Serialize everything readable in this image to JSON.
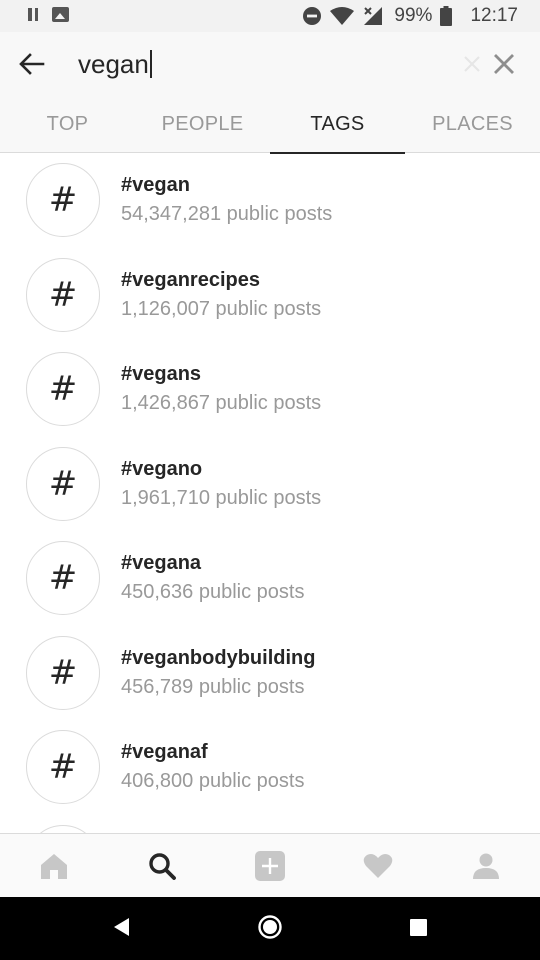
{
  "status_bar": {
    "battery_percent": "99%",
    "time": "12:17"
  },
  "search": {
    "query": "vegan"
  },
  "tabs": [
    {
      "label": "TOP",
      "active": false
    },
    {
      "label": "PEOPLE",
      "active": false
    },
    {
      "label": "TAGS",
      "active": true
    },
    {
      "label": "PLACES",
      "active": false
    }
  ],
  "results": [
    {
      "symbol": "#",
      "tag": "#vegan",
      "posts": "54,347,281 public posts"
    },
    {
      "symbol": "#",
      "tag": "#veganrecipes",
      "posts": "1,126,007 public posts"
    },
    {
      "symbol": "#",
      "tag": "#vegans",
      "posts": "1,426,867 public posts"
    },
    {
      "symbol": "#",
      "tag": "#vegano",
      "posts": "1,961,710 public posts"
    },
    {
      "symbol": "#",
      "tag": "#vegana",
      "posts": "450,636 public posts"
    },
    {
      "symbol": "#",
      "tag": "#veganbodybuilding",
      "posts": "456,789 public posts"
    },
    {
      "symbol": "#",
      "tag": "#veganaf",
      "posts": "406,800 public posts"
    },
    {
      "symbol": "",
      "tag": "",
      "posts": ""
    }
  ],
  "bottom_nav": {
    "items": [
      "home-icon",
      "search-icon",
      "add-post-icon",
      "heart-icon",
      "profile-icon"
    ],
    "active": "search-icon"
  },
  "colors": {
    "text_primary": "#262626",
    "text_secondary": "#999999",
    "border": "#dbdbdb",
    "inactive_icon": "#c7c7c7"
  }
}
